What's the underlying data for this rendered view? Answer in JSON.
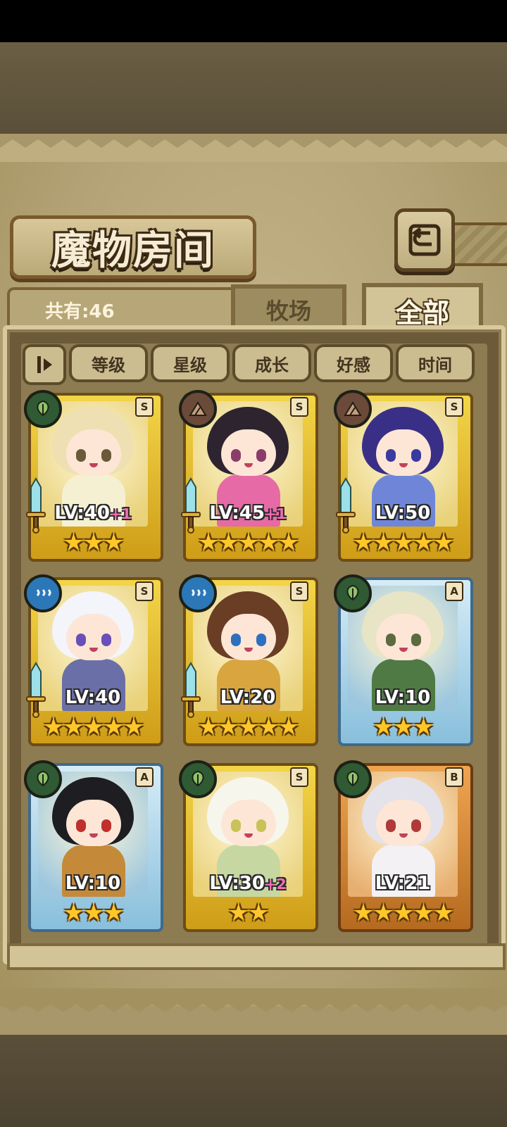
{
  "header": {
    "title": "魔物房间",
    "back_icon": "return-arrow-icon"
  },
  "tabs": {
    "count_label": "共有:46",
    "farm_label": "牧场",
    "all_label": "全部",
    "active": "全部"
  },
  "sort": {
    "toggle_icon": "sort-order-icon",
    "buttons": [
      "等级",
      "星级",
      "成长",
      "好感",
      "时间"
    ]
  },
  "monsters": [
    {
      "level": "LV:40",
      "bonus": "+1",
      "rank": "S",
      "element": "leaf",
      "frame": "gold",
      "stars": "★★★",
      "has_weapon": true
    },
    {
      "level": "LV:45",
      "bonus": "+1",
      "rank": "S",
      "element": "mountain",
      "frame": "gold",
      "stars": "★★★★★",
      "has_weapon": true
    },
    {
      "level": "LV:50",
      "bonus": "",
      "rank": "S",
      "element": "mountain",
      "frame": "gold",
      "stars": "★★★★★",
      "has_weapon": true
    },
    {
      "level": "LV:40",
      "bonus": "",
      "rank": "S",
      "element": "water",
      "frame": "gold",
      "stars": "★★★★★",
      "has_weapon": true
    },
    {
      "level": "LV:20",
      "bonus": "",
      "rank": "S",
      "element": "water",
      "frame": "gold",
      "stars": "★★★★★",
      "has_weapon": true
    },
    {
      "level": "LV:10",
      "bonus": "",
      "rank": "A",
      "element": "leaf",
      "frame": "blue",
      "stars": "★★★",
      "has_weapon": false
    },
    {
      "level": "LV:10",
      "bonus": "",
      "rank": "A",
      "element": "leaf",
      "frame": "blue",
      "stars": "★★★",
      "has_weapon": false
    },
    {
      "level": "LV:30",
      "bonus": "+2",
      "rank": "S",
      "element": "leaf",
      "frame": "gold",
      "stars": "★★",
      "has_weapon": false
    },
    {
      "level": "LV:21",
      "bonus": "",
      "rank": "B",
      "element": "leaf",
      "frame": "bronze",
      "stars": "★★★★★",
      "has_weapon": false
    }
  ],
  "colors": {
    "gold_frame": "#f3d548",
    "blue_frame": "#88bfdc",
    "bronze_frame": "#efa550",
    "star": "#ffc72a",
    "bonus": "#f06fb6"
  }
}
